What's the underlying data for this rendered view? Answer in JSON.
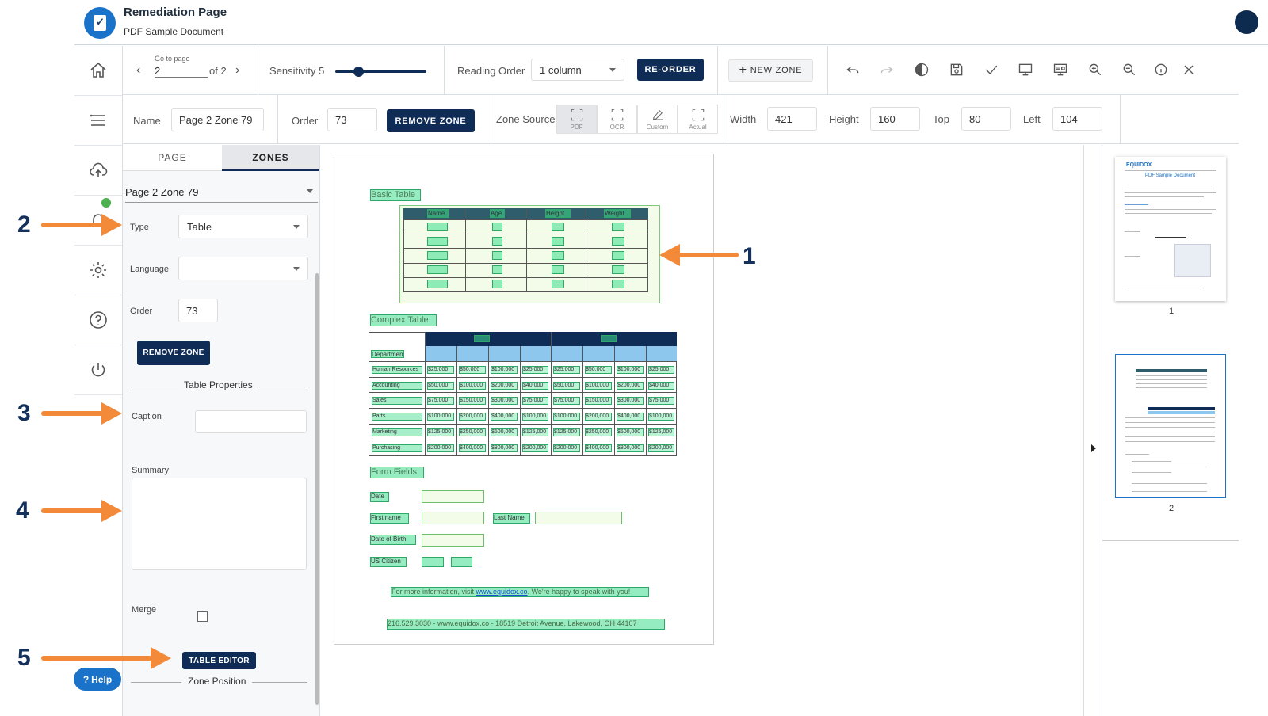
{
  "header": {
    "title": "Remediation Page",
    "subtitle": "PDF Sample Document"
  },
  "toolbar": {
    "goto_label": "Go to page",
    "page_value": "2",
    "page_of": "of 2",
    "sensitivity_label": "Sensitivity 5",
    "sensitivity_level": 0.25,
    "reading_order_label": "Reading Order",
    "reading_order_value": "1 column",
    "reorder_button": "RE-ORDER",
    "new_zone_button": "NEW ZONE"
  },
  "zone_bar": {
    "name_label": "Name",
    "name_value": "Page 2 Zone 79",
    "order_label": "Order",
    "order_value": "73",
    "remove_button": "REMOVE ZONE",
    "source_label": "Zone Source",
    "sources": [
      "PDF",
      "OCR",
      "Custom",
      "Actual"
    ],
    "width_label": "Width",
    "width_value": "421",
    "height_label": "Height",
    "height_value": "160",
    "top_label": "Top",
    "top_value": "80",
    "left_label": "Left",
    "left_value": "104"
  },
  "panel": {
    "tabs": [
      "PAGE",
      "ZONES"
    ],
    "zone_select": "Page 2 Zone 79",
    "type_label": "Type",
    "type_value": "Table",
    "language_label": "Language",
    "language_value": "",
    "order_label": "Order",
    "order_value": "73",
    "remove_button": "REMOVE ZONE",
    "table_props": "Table Properties",
    "caption_label": "Caption",
    "summary_label": "Summary",
    "merge_label": "Merge",
    "table_editor_button": "TABLE EDITOR",
    "zone_position": "Zone Position",
    "help_button": "Help"
  },
  "document": {
    "basic_table_title": "Basic Table",
    "basic_headers": [
      "Name",
      "Age",
      "Height",
      "Weight"
    ],
    "complex_table_title": "Complex Table",
    "complex_rows": [
      [
        "Human Resources",
        "$25,000",
        "$50,000",
        "$100,000",
        "$25,000",
        "$25,000",
        "$50,000",
        "$100,000",
        "$25,000"
      ],
      [
        "Accounting",
        "$50,000",
        "$100,000",
        "$200,000",
        "$40,000",
        "$50,000",
        "$100,000",
        "$200,000",
        "$40,000"
      ],
      [
        "Sales",
        "$75,000",
        "$150,000",
        "$300,000",
        "$75,000",
        "$75,000",
        "$150,000",
        "$300,000",
        "$75,000"
      ],
      [
        "Parts",
        "$100,000",
        "$200,000",
        "$400,000",
        "$100,000",
        "$100,000",
        "$200,000",
        "$400,000",
        "$100,000"
      ],
      [
        "Marketing",
        "$125,000",
        "$250,000",
        "$500,000",
        "$125,000",
        "$125,000",
        "$250,000",
        "$500,000",
        "$125,000"
      ],
      [
        "Purchasing",
        "$200,000",
        "$400,000",
        "$800,000",
        "$200,000",
        "$200,000",
        "$400,000",
        "$800,000",
        "$200,000"
      ]
    ],
    "department_label": "Department",
    "form_fields_title": "Form Fields",
    "form_date": "Date",
    "form_first_name": "First name",
    "form_last_name": "Last Name",
    "form_dob": "Date of Birth",
    "form_us_citizen": "US Citizen",
    "footer_info_prefix": "For more information, visit ",
    "footer_link": "www.equidox.co",
    "footer_info_suffix": ". We're happy to speak with you!",
    "footer_address": "216.529.3030 - www.equidox.co - 18519 Detroit Avenue, Lakewood, OH 44107"
  },
  "thumbnails": [
    {
      "label": "1",
      "brand": "EQUIDOX",
      "title": "PDF Sample Document"
    },
    {
      "label": "2"
    }
  ],
  "annotations": [
    "1",
    "2",
    "3",
    "4",
    "5"
  ],
  "colors": {
    "accent": "#0f2c56",
    "arrow": "#f28a3a",
    "zone": "#3cdc8c"
  }
}
